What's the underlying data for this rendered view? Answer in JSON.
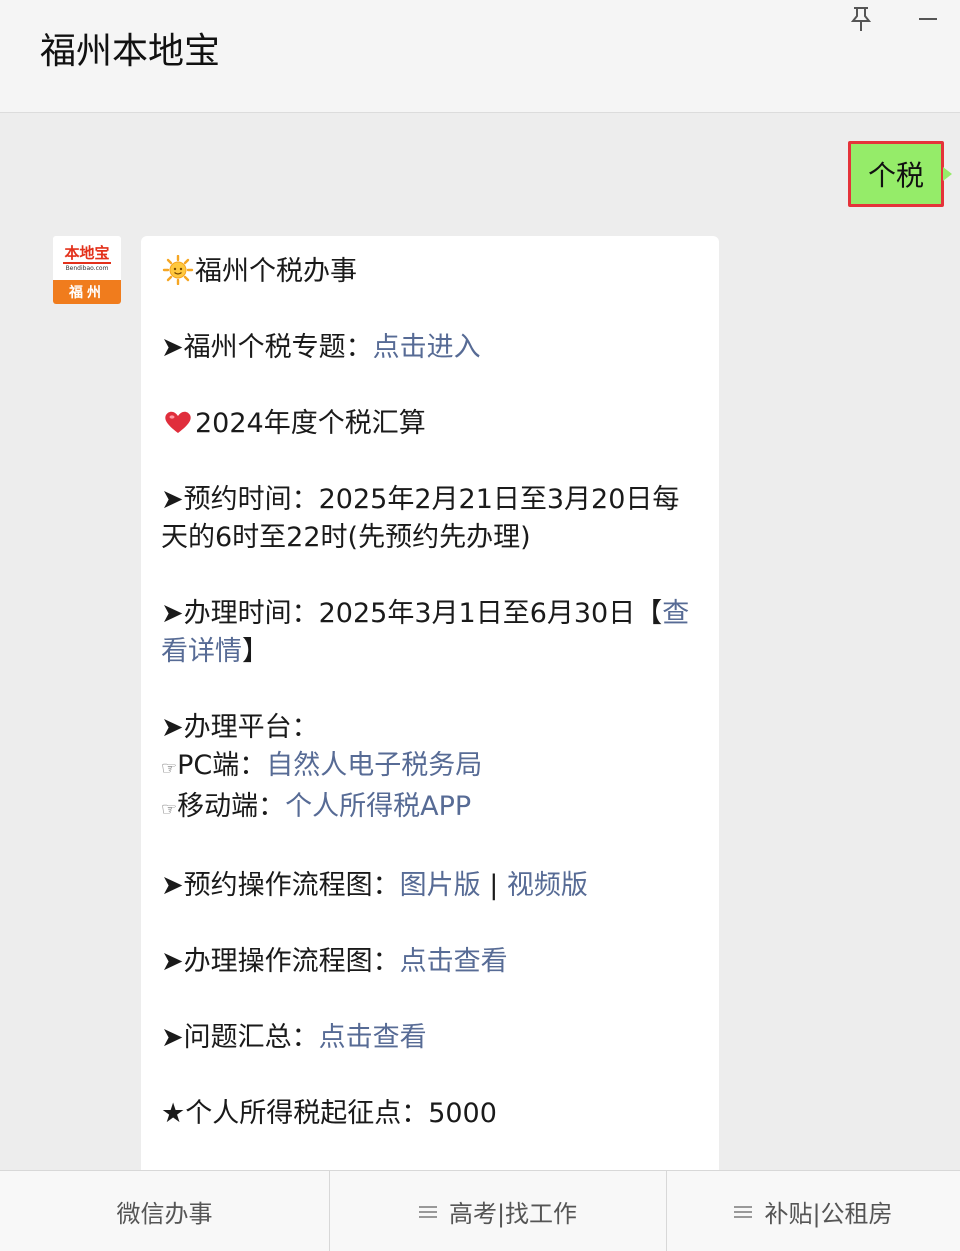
{
  "header": {
    "title": "福州本地宝"
  },
  "sent_message": {
    "text": "个税"
  },
  "avatar": {
    "logo_text": "本地宝",
    "domain_text": "Bendibao.com",
    "city_text": "福州"
  },
  "received_message": {
    "heading": "福州个税办事",
    "topic_prefix": "➤福州个税专题：",
    "topic_link": "点击进入",
    "annual_title": "2024年度个税汇算",
    "appointment": "➤预约时间：2025年2月21日至3月20日每天的6时至22时(先预约先办理)",
    "handle_prefix": "➤办理时间：2025年3月1日至6月30日【",
    "handle_link": "查看详情",
    "handle_suffix": "】",
    "platform_label": "➤办理平台：",
    "pc_prefix": "PC端：",
    "pc_link": "自然人电子税务局",
    "mobile_prefix": "移动端：",
    "mobile_link": "个人所得税APP",
    "appt_flow_prefix": "➤预约操作流程图：",
    "appt_flow_link1": "图片版",
    "appt_flow_sep": " | ",
    "appt_flow_link2": "视频版",
    "handle_flow_prefix": "➤办理操作流程图：",
    "handle_flow_link": "点击查看",
    "faq_prefix": "➤问题汇总：",
    "faq_link": "点击查看",
    "threshold": "★个人所得税起征点：5000"
  },
  "bottom_menu": {
    "items": [
      {
        "label": "微信办事",
        "has_submenu": false
      },
      {
        "label": "高考|找工作",
        "has_submenu": true
      },
      {
        "label": "补贴|公租房",
        "has_submenu": true
      }
    ]
  },
  "colors": {
    "link": "#576b95",
    "sent_bubble": "#95ec69",
    "highlight_border": "#e5333a",
    "background": "#ededed"
  },
  "icons": {
    "window_controls": [
      "pin-icon",
      "minimize-icon"
    ],
    "message_emoji": [
      "sun-emoji-icon",
      "heart-emoji-icon",
      "pointing-hand-icon"
    ]
  }
}
